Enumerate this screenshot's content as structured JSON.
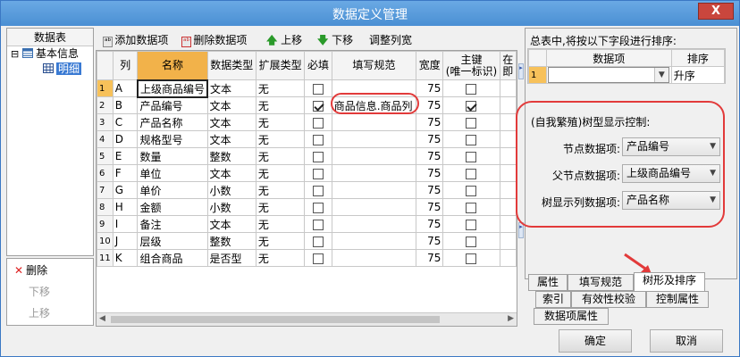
{
  "window": {
    "title": "数据定义管理",
    "close_symbol": "X"
  },
  "tree": {
    "header": "数据表",
    "root_label": "基本信息",
    "child_label": "明细",
    "expander": "⊟"
  },
  "left_actions": {
    "delete": "删除",
    "move_down": "下移",
    "move_up": "上移"
  },
  "toolbar": {
    "add": "添加数据项",
    "remove": "删除数据项",
    "up": "上移",
    "down": "下移",
    "adjust": "调整列宽"
  },
  "grid": {
    "columns": [
      "列",
      "名称",
      "数据类型",
      "扩展类型",
      "必填",
      "填写规范",
      "宽度",
      "主键\n(唯一标识)",
      "在\n即"
    ],
    "rows": [
      {
        "n": "1",
        "col": "A",
        "name": "上级商品编号",
        "type": "文本",
        "ext": "无",
        "req": false,
        "rule": "",
        "width": "75",
        "key": false
      },
      {
        "n": "2",
        "col": "B",
        "name": "产品编号",
        "type": "文本",
        "ext": "无",
        "req": true,
        "rule": "商品信息.商品列",
        "width": "75",
        "key": true
      },
      {
        "n": "3",
        "col": "C",
        "name": "产品名称",
        "type": "文本",
        "ext": "无",
        "req": false,
        "rule": "",
        "width": "75",
        "key": false
      },
      {
        "n": "4",
        "col": "D",
        "name": "规格型号",
        "type": "文本",
        "ext": "无",
        "req": false,
        "rule": "",
        "width": "75",
        "key": false
      },
      {
        "n": "5",
        "col": "E",
        "name": "数量",
        "type": "整数",
        "ext": "无",
        "req": false,
        "rule": "",
        "width": "75",
        "key": false
      },
      {
        "n": "6",
        "col": "F",
        "name": "单位",
        "type": "文本",
        "ext": "无",
        "req": false,
        "rule": "",
        "width": "75",
        "key": false
      },
      {
        "n": "7",
        "col": "G",
        "name": "单价",
        "type": "小数",
        "ext": "无",
        "req": false,
        "rule": "",
        "width": "75",
        "key": false
      },
      {
        "n": "8",
        "col": "H",
        "name": "金额",
        "type": "小数",
        "ext": "无",
        "req": false,
        "rule": "",
        "width": "75",
        "key": false
      },
      {
        "n": "9",
        "col": "I",
        "name": "备注",
        "type": "文本",
        "ext": "无",
        "req": false,
        "rule": "",
        "width": "75",
        "key": false
      },
      {
        "n": "10",
        "col": "J",
        "name": "层级",
        "type": "整数",
        "ext": "无",
        "req": false,
        "rule": "",
        "width": "75",
        "key": false
      },
      {
        "n": "11",
        "col": "K",
        "name": "组合商品",
        "type": "是否型",
        "ext": "无",
        "req": false,
        "rule": "",
        "width": "75",
        "key": false
      }
    ]
  },
  "sort": {
    "heading": "总表中,将按以下字段进行排序:",
    "col_field": "数据项",
    "col_order": "排序",
    "row_num": "1",
    "row_field": "",
    "row_order": "升序"
  },
  "tree_display": {
    "heading": "(自我繁殖)树型显示控制:",
    "node_label": "节点数据项:",
    "node_value": "产品编号",
    "parent_label": "父节点数据项:",
    "parent_value": "上级商品编号",
    "display_label": "树显示列数据项:",
    "display_value": "产品名称"
  },
  "tabs": {
    "row1": [
      "属性",
      "填写规范",
      "树形及排序"
    ],
    "row2": [
      "索引",
      "有效性校验",
      "控制属性"
    ],
    "row3": [
      "数据项属性"
    ]
  },
  "buttons": {
    "ok": "确定",
    "cancel": "取消"
  },
  "colors": {
    "accent": "#f2b24a",
    "highlight": "#e23a3a",
    "selection": "#3a7ad3"
  }
}
